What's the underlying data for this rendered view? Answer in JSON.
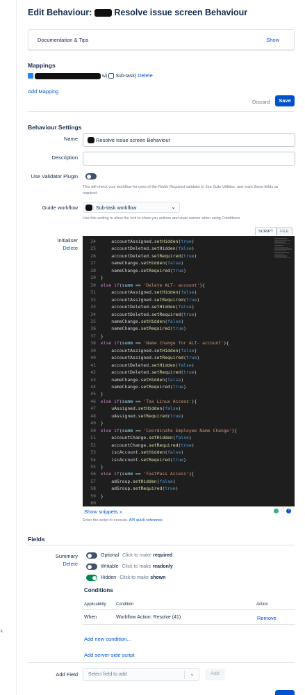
{
  "header": {
    "title_prefix": "Edit Behaviour:",
    "title_suffix": "Resolve issue screen Behaviour"
  },
  "doc_panel": {
    "label": "Documentation & Tips",
    "show": "Show"
  },
  "mappings": {
    "heading": "Mappings",
    "mapping_tail": "w)",
    "subtask_label": "Sub-task)",
    "delete": "Delete",
    "add_mapping": "Add Mapping"
  },
  "actions": {
    "discard": "Discard",
    "save": "Save"
  },
  "settings": {
    "heading": "Behaviour Settings",
    "name_label": "Name",
    "name_value": "Resolve issue screen Behaviour",
    "description_label": "Description",
    "description_value": "",
    "validator_label": "Use Validator Plugin",
    "validator_help_1": "This will check your workflow for uses of the",
    "validator_help_em": "Fields Required",
    "validator_help_2": "validator in Jira Suite Utilities, and mark these fields",
    "validator_help_3": "as required.",
    "guide_label": "Guide workflow",
    "guide_value": ": Sub-task workflow",
    "guide_help": "Use this setting to allow the tool to show you actions and state names when using Conditions."
  },
  "initialiser": {
    "label": "Initialiser",
    "delete": "Delete",
    "tab_script": "SCRIPT",
    "tab_file": "FILE",
    "code_lines": [
      {
        "n": "24",
        "code": "    accountAssigned.setHidden(true)"
      },
      {
        "n": "25",
        "code": "    accountDeleted.setHidden(false)"
      },
      {
        "n": "26",
        "code": "    accountDeleted.setRequired(true)"
      },
      {
        "n": "27",
        "code": "    nameChange.setHidden(false)"
      },
      {
        "n": "28",
        "code": "    nameChange.setRequired(true)"
      },
      {
        "n": "29",
        "code": "}"
      },
      {
        "n": "30",
        "code": "else if(summ == 'Delete ALT- account'){"
      },
      {
        "n": "31",
        "code": "    accountAssigned.setHidden(false)"
      },
      {
        "n": "32",
        "code": "    accountAssigned.setRequired(true)"
      },
      {
        "n": "33",
        "code": "    accountDeleted.setHidden(false)"
      },
      {
        "n": "34",
        "code": "    accountDeleted.setRequired(true)"
      },
      {
        "n": "35",
        "code": "    nameChange.setHidden(false)"
      },
      {
        "n": "36",
        "code": "    nameChange.setRequired(true)"
      },
      {
        "n": "37",
        "code": "}"
      },
      {
        "n": "38",
        "code": "else if(summ == 'Name Change for ALT- account'){"
      },
      {
        "n": "39",
        "code": "    accountAssigned.setHidden(false)"
      },
      {
        "n": "40",
        "code": "    accountAssigned.setRequired(true)"
      },
      {
        "n": "41",
        "code": "    accountDeleted.setHidden(false)"
      },
      {
        "n": "42",
        "code": "    accountDeleted.setRequired(true)"
      },
      {
        "n": "43",
        "code": "    nameChange.setHidden(false)"
      },
      {
        "n": "44",
        "code": "    nameChange.setRequired(true)"
      },
      {
        "n": "45",
        "code": "}"
      },
      {
        "n": "46",
        "code": "else if(summ == 'Tax Linux Access'){"
      },
      {
        "n": "47",
        "code": "    uAssigned.setHidden(false)"
      },
      {
        "n": "48",
        "code": "    uAssigned.setRequired(true)"
      },
      {
        "n": "49",
        "code": "}"
      },
      {
        "n": "50",
        "code": "else if(summ == 'Coordinate Employee Name Change'){"
      },
      {
        "n": "51",
        "code": "    accountChange.setHidden(false)"
      },
      {
        "n": "52",
        "code": "    accountChange.setRequired(true)"
      },
      {
        "n": "53",
        "code": "    iscAccount.setHidden(false)"
      },
      {
        "n": "54",
        "code": "    iscAccount.setRequired(true)"
      },
      {
        "n": "55",
        "code": "}"
      },
      {
        "n": "56",
        "code": "else if(summ == 'FastPass Access'){"
      },
      {
        "n": "57",
        "code": "    adGroup.setHidden(false)"
      },
      {
        "n": "58",
        "code": "    adGroup.setRequired(true)"
      },
      {
        "n": "59",
        "code": "}"
      },
      {
        "n": "60",
        "code": ""
      }
    ],
    "show_snippets": "Show snippets",
    "help_1": "Enter the script to execute.",
    "help_link": "API quick reference."
  },
  "fields": {
    "heading": "Fields",
    "field_name": "Summary",
    "field_delete": "Delete",
    "opt_optional": "Optional",
    "opt_optional_hint": "Click to make",
    "opt_optional_target": "required",
    "opt_writable": "Writable",
    "opt_writable_hint": "Click to make",
    "opt_writable_target": "readonly",
    "opt_hidden": "Hidden",
    "opt_hidden_hint": "Click to make",
    "opt_hidden_target": "shown",
    "conditions_heading": "Conditions",
    "col_applicability": "Applicability",
    "col_condition": "Condition",
    "col_action": "Action",
    "row_when": "When",
    "row_condition": "Workflow Action: Resolve (41)",
    "row_remove": "Remove",
    "add_condition": "Add new condition...",
    "add_server_script": "Add server-side script"
  },
  "add_field": {
    "label": "Add Field",
    "placeholder": "Select field to add",
    "button": "Add"
  },
  "left_margin_text": "k",
  "colors": {
    "primary": "#0052cc",
    "code_bg": "#1e1e1e",
    "toggle_on": "#00875a",
    "toggle_off": "#42526e"
  }
}
